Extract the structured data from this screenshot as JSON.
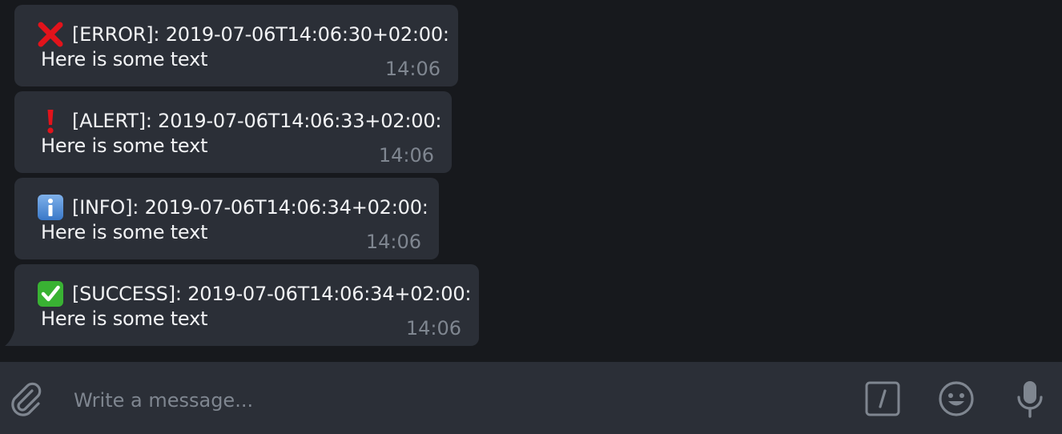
{
  "messages": [
    {
      "type": "error",
      "icon": "cross-mark-icon",
      "header": "[ERROR]: 2019-07-06T14:06:30+02:00:",
      "body": "Here is some text",
      "time": "14:06"
    },
    {
      "type": "alert",
      "icon": "exclamation-mark-icon",
      "header": "[ALERT]: 2019-07-06T14:06:33+02:00:",
      "body": "Here is some text",
      "time": "14:06"
    },
    {
      "type": "info",
      "icon": "information-icon",
      "header": "[INFO]: 2019-07-06T14:06:34+02:00:",
      "body": "Here is some text",
      "time": "14:06"
    },
    {
      "type": "success",
      "icon": "check-mark-icon",
      "header": "[SUCCESS]: 2019-07-06T14:06:34+02:00:",
      "body": "Here is some text",
      "time": "14:06"
    }
  ],
  "composer": {
    "placeholder": "Write a message...",
    "attach_icon": "paperclip-icon",
    "commands_icon": "slash-commands-icon",
    "emoji_icon": "smiley-icon",
    "voice_icon": "microphone-icon"
  },
  "colors": {
    "background": "#17191d",
    "bubble": "#2b2f37",
    "text": "#f2f3f5",
    "muted": "#7f8690",
    "error": "#e2131b",
    "info": "#4a88d6",
    "success": "#39b233"
  }
}
